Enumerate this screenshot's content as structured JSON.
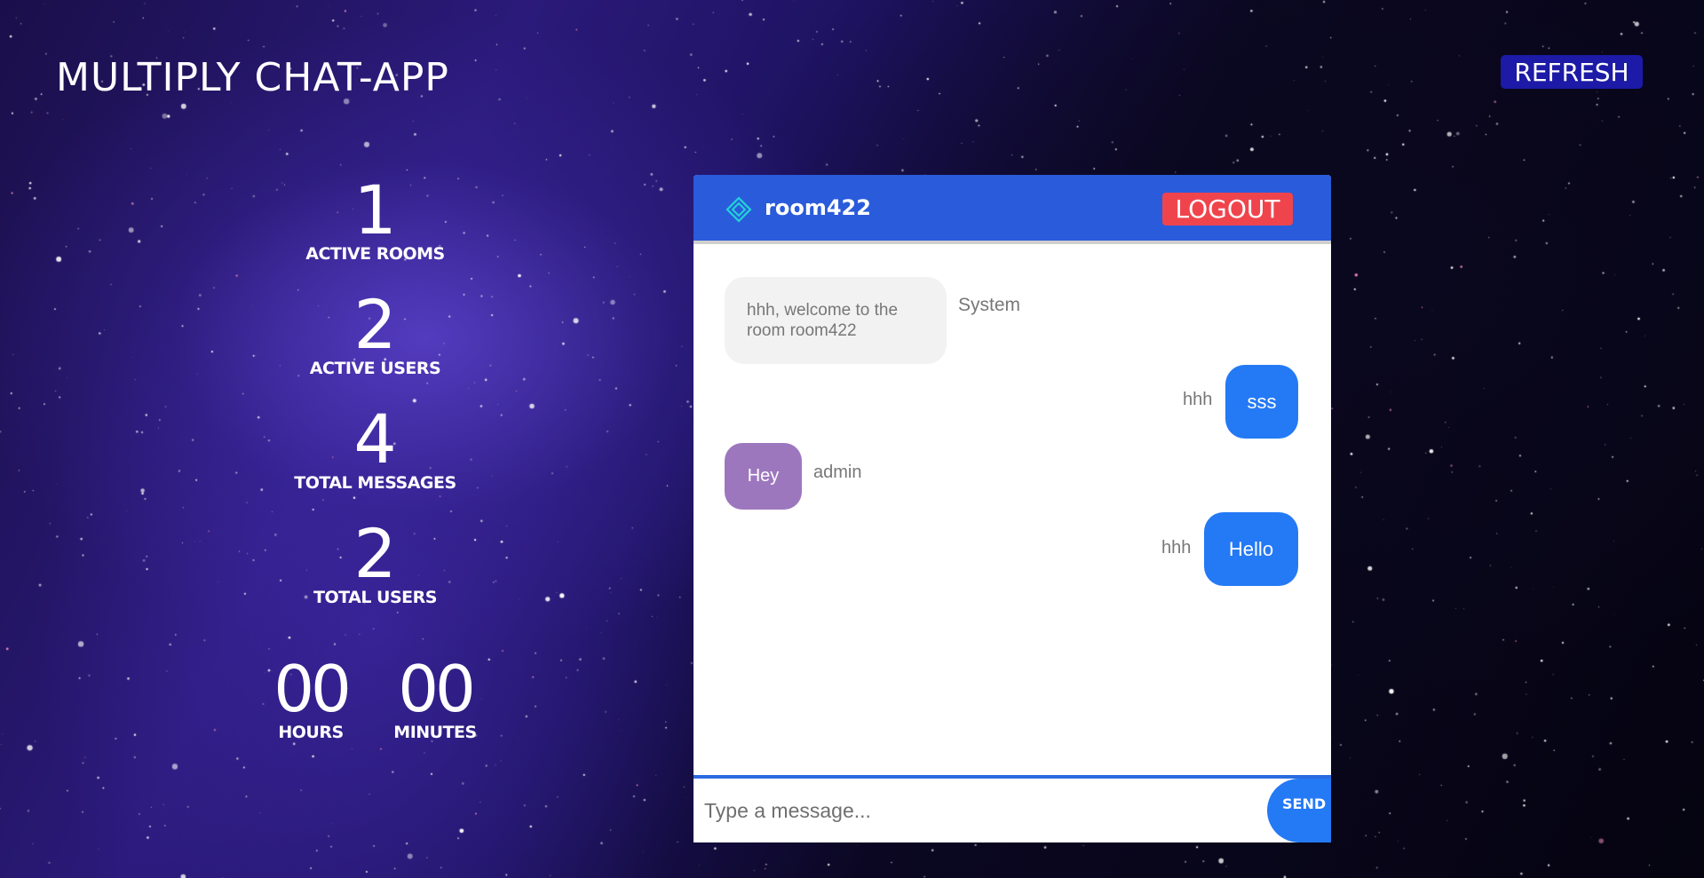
{
  "app": {
    "title": "MULTIPLY CHAT-APP",
    "refresh_label": "REFRESH"
  },
  "stats": [
    {
      "value": "1",
      "label": "ACTIVE ROOMS"
    },
    {
      "value": "2",
      "label": "ACTIVE USERS"
    },
    {
      "value": "4",
      "label": "TOTAL MESSAGES"
    },
    {
      "value": "2",
      "label": "TOTAL USERS"
    }
  ],
  "timer": {
    "hours": {
      "value": "00",
      "label": "HOURS"
    },
    "minutes": {
      "value": "00",
      "label": "MINUTES"
    }
  },
  "chat": {
    "room_icon": "diamond-icon",
    "room_name": "room422",
    "logout_label": "LOGOUT",
    "messages": [
      {
        "text": "hhh, welcome to the room room422",
        "sender": "System"
      },
      {
        "text": "sss",
        "sender": "hhh"
      },
      {
        "text": "Hey",
        "sender": "admin"
      },
      {
        "text": "Hello",
        "sender": "hhh"
      }
    ],
    "input_placeholder": "Type a message...",
    "input_value": "",
    "send_label": "SEND"
  },
  "colors": {
    "header_blue": "#2a5bdb",
    "logout_red": "#f0444d",
    "refresh_blue": "#1c1aa6",
    "own_bubble": "#2479f5",
    "other_bubble": "#9d77be",
    "system_bubble": "#f2f2f2",
    "icon_cyan": "#22d3d8"
  }
}
